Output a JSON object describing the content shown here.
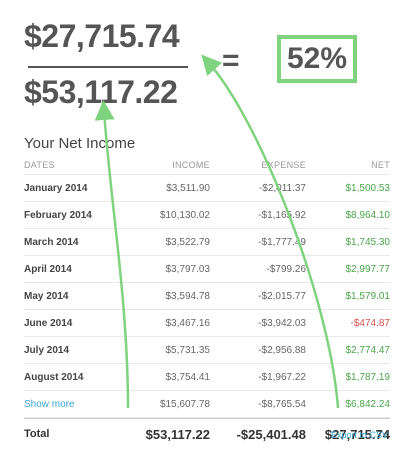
{
  "formula": {
    "numerator": "$27,715.74",
    "denominator": "$53,117.22",
    "equals": "=",
    "result": "52%"
  },
  "table": {
    "title": "Your Net Income",
    "columns": {
      "date": "DATES",
      "income": "INCOME",
      "expense": "EXPENSE",
      "net": "NET"
    },
    "rows": [
      {
        "date": "January 2014",
        "income": "$3,511.90",
        "expense": "-$2,011.37",
        "net": "$1,500.53",
        "net_sign": "pos"
      },
      {
        "date": "February 2014",
        "income": "$10,130.02",
        "expense": "-$1,165.92",
        "net": "$8,964.10",
        "net_sign": "pos"
      },
      {
        "date": "March 2014",
        "income": "$3,522.79",
        "expense": "-$1,777.49",
        "net": "$1,745.30",
        "net_sign": "pos"
      },
      {
        "date": "April 2014",
        "income": "$3,797.03",
        "expense": "-$799.26",
        "net": "$2,997.77",
        "net_sign": "pos"
      },
      {
        "date": "May 2014",
        "income": "$3,594.78",
        "expense": "-$2,015.77",
        "net": "$1,579.01",
        "net_sign": "pos"
      },
      {
        "date": "June 2014",
        "income": "$3,467.16",
        "expense": "-$3,942.03",
        "net": "-$474.87",
        "net_sign": "neg"
      },
      {
        "date": "July 2014",
        "income": "$5,731.35",
        "expense": "-$2,956.88",
        "net": "$2,774.47",
        "net_sign": "pos"
      },
      {
        "date": "August 2014",
        "income": "$3,754.41",
        "expense": "-$1,967.22",
        "net": "$1,787.19",
        "net_sign": "pos"
      }
    ],
    "show_more": {
      "label": "Show more",
      "income": "$15,607.78",
      "expense": "-$8,765.54",
      "net": "$6,842.24"
    },
    "total": {
      "label": "Total",
      "income": "$53,117.22",
      "expense": "-$25,401.48",
      "net": "$27,715.74"
    },
    "export_label": "Export to CSV"
  },
  "colors": {
    "positive": "#4aa64a",
    "negative": "#d9534f",
    "link": "#3aa6d6",
    "highlight": "#7fd37f"
  }
}
